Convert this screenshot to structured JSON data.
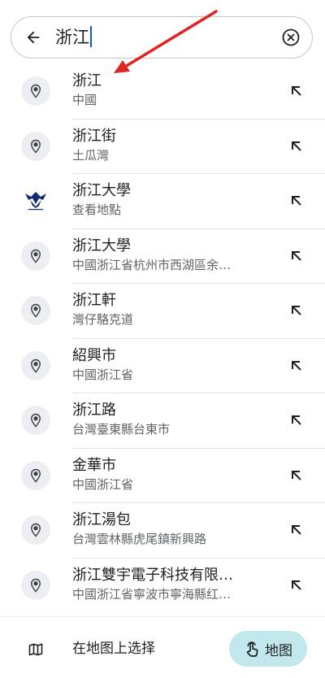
{
  "search": {
    "query": "浙江"
  },
  "results": [
    {
      "title": "浙江",
      "subtitle": "中國",
      "icon": "pin-icon"
    },
    {
      "title": "浙江街",
      "subtitle": "土瓜灣",
      "icon": "pin-icon"
    },
    {
      "title": "浙江大學",
      "subtitle": "查看地點",
      "icon": "university-logo"
    },
    {
      "title": "浙江大學",
      "subtitle": "中國浙江省杭州市西湖區余…",
      "icon": "pin-icon"
    },
    {
      "title": "浙江軒",
      "subtitle": "灣仔駱克道",
      "icon": "pin-icon"
    },
    {
      "title": "紹興市",
      "subtitle": "中國浙江省",
      "icon": "pin-icon"
    },
    {
      "title": "浙江路",
      "subtitle": "台灣臺東縣台東市",
      "icon": "pin-icon"
    },
    {
      "title": "金華市",
      "subtitle": "中國浙江省",
      "icon": "pin-icon"
    },
    {
      "title": "浙江湯包",
      "subtitle": "台灣雲林縣虎尾鎮新興路",
      "icon": "pin-icon"
    },
    {
      "title": "浙江雙宇電子科技有限…",
      "subtitle": "中國浙江省寧波市寧海縣红…",
      "icon": "pin-icon"
    }
  ],
  "bottom": {
    "choose_on_map": "在地图上选择",
    "map_button": "地图"
  },
  "colors": {
    "pin_bg": "#eceef1",
    "map_button_bg": "#c2e7ec",
    "annotation_arrow": "#e02424",
    "caret": "#0b57d0"
  }
}
